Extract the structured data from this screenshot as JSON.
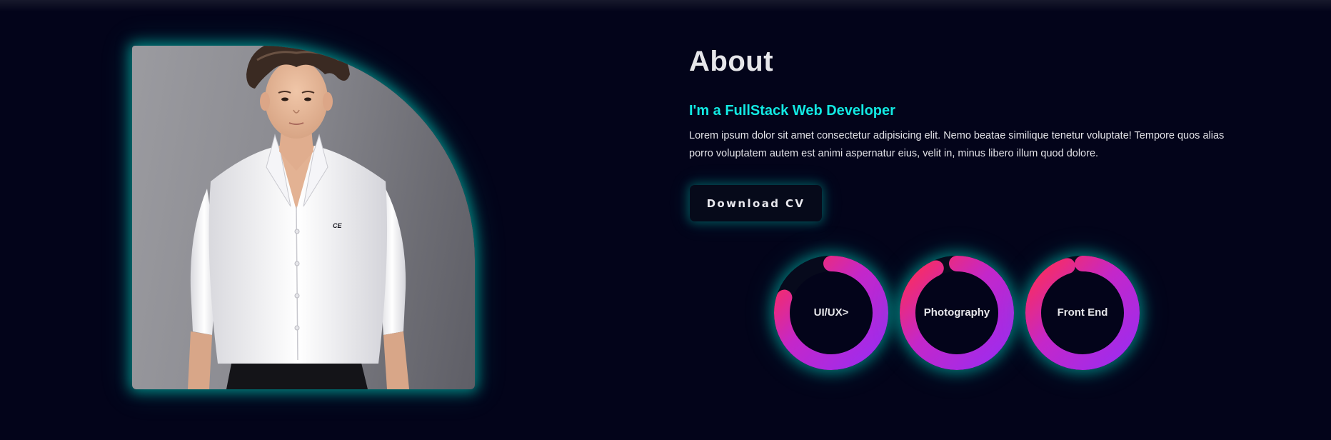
{
  "about": {
    "title": "About",
    "role": "I'm a FullStack Web Developer",
    "bio": "Lorem ipsum dolor sit amet consectetur adipisicing elit. Nemo beatae similique tenetur voluptate! Tempore quos alias porro voluptatem autem est animi aspernatur eius, velit in, minus libero illum quod dolore.",
    "cv_button": "Download CV"
  },
  "portrait": {
    "shirt_logo": "CE"
  },
  "skills": [
    {
      "label": "UI/UX>",
      "percent": 80
    },
    {
      "label": "Photography",
      "percent": 93
    },
    {
      "label": "Front End",
      "percent": 95
    }
  ],
  "colors": {
    "background": "#03041a",
    "accent_cyan": "#12e9e3",
    "ring_gradient_start": "#9b2cf0",
    "ring_gradient_end": "#ff2d55",
    "glow": "#00dcc8"
  }
}
